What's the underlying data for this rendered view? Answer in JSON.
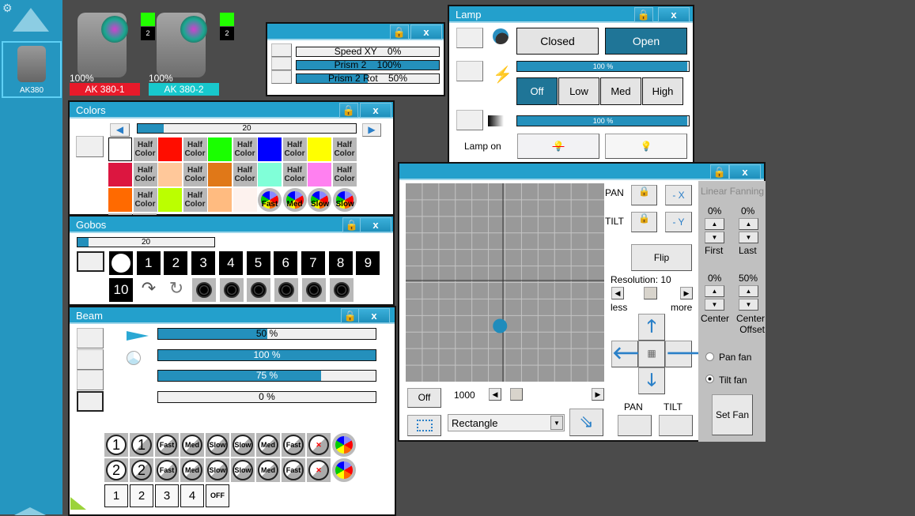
{
  "sidebar": {
    "fixture_label": "AK380",
    "accent": "#2596c0"
  },
  "fixtures": [
    {
      "name": "AK 380-1",
      "intensity": "100%",
      "badge": "2",
      "color": "#e81a2a"
    },
    {
      "name": "AK 380-2",
      "intensity": "100%",
      "badge": "2",
      "color": "#18c8cc"
    }
  ],
  "effects_panel": {
    "rows": [
      {
        "label": "Speed XY",
        "value": "0%",
        "fill": 0
      },
      {
        "label": "Prism 2",
        "value": "100%",
        "fill": 100
      },
      {
        "label": "Prism 2 Rot",
        "value": "50%",
        "fill": 50
      }
    ]
  },
  "lamp": {
    "title": "Lamp",
    "closed": "Closed",
    "open": "Open",
    "shutter_bar": "100 %",
    "modes": [
      "Off",
      "Low",
      "Med",
      "High"
    ],
    "dimmer_bar": "100 %",
    "lamp_on": "Lamp on"
  },
  "colors": {
    "title": "Colors",
    "scroll_value": "20",
    "scroll_fill": 12,
    "cells": [
      {
        "c": "#ffffff"
      },
      {
        "t": "Half Color"
      },
      {
        "c": "#ff0d00"
      },
      {
        "t": "Half Color"
      },
      {
        "c": "#1aff00"
      },
      {
        "t": "Half Color"
      },
      {
        "c": "#0000ff"
      },
      {
        "t": "Half Color"
      },
      {
        "c": "#ffff00"
      },
      {
        "t": "Half Color"
      },
      {
        "c": "#dc1640"
      },
      {
        "t": "Half Color"
      },
      {
        "c": "#ffc89a"
      },
      {
        "t": "Half Color"
      },
      {
        "c": "#e07818"
      },
      {
        "t": "Half Color"
      },
      {
        "c": "#80ffd8"
      },
      {
        "t": "Half Color"
      },
      {
        "c": "#ff80f0"
      },
      {
        "t": "Half Color"
      },
      {
        "c": "#ff6a00"
      },
      {
        "t": "Half Color"
      },
      {
        "c": "#bbff00"
      },
      {
        "t": "Half Color"
      },
      {
        "c": "#ffbb80"
      },
      {
        "c": "#fdf2ee"
      },
      {
        "w": "Fast"
      },
      {
        "w": "Med"
      },
      {
        "w": "Slow"
      },
      {
        "w": "Slow"
      }
    ]
  },
  "gobos": {
    "title": "Gobos",
    "scroll_value": "20",
    "scroll_fill": 8,
    "row1": [
      "",
      "1",
      "2",
      "3",
      "4",
      "5",
      "6",
      "7",
      "8",
      "9"
    ],
    "row2_label": "10"
  },
  "beam": {
    "title": "Beam",
    "bars": [
      {
        "value": "50 %",
        "fill": 50
      },
      {
        "value": "100 %",
        "fill": 100
      },
      {
        "value": "75 %",
        "fill": 75
      },
      {
        "value": "0 %",
        "fill": 0
      }
    ],
    "row1": [
      "1",
      "1",
      "Fast",
      "Med",
      "Slow",
      "Slow",
      "Med",
      "Fast",
      "",
      ""
    ],
    "row2": [
      "2",
      "2",
      "Fast",
      "Med",
      "Slow",
      "Slow",
      "Med",
      "Fast",
      "",
      ""
    ],
    "row3": [
      "1",
      "2",
      "3",
      "4",
      "OFF"
    ]
  },
  "position": {
    "pan": "PAN",
    "tilt": "TILT",
    "neg_x": "- X",
    "neg_y": "- Y",
    "flip": "Flip",
    "resolution": "Resolution: 10",
    "less": "less",
    "more": "more",
    "off": "Off",
    "speed": "1000",
    "shape": "Rectangle",
    "pan_btn": "PAN",
    "tilt_btn": "TILT",
    "dot": {
      "pan": -0.03,
      "tilt": -0.46
    }
  },
  "fanning": {
    "title": "Linear Fanning",
    "first_val": "0%",
    "last_val": "0%",
    "first": "First",
    "last": "Last",
    "center_val": "0%",
    "offset_val": "50%",
    "center": "Center",
    "center_offset": "Center Offset",
    "pan_fan": "Pan fan",
    "tilt_fan": "Tilt fan",
    "selected": "tilt",
    "set_fan": "Set Fan"
  }
}
